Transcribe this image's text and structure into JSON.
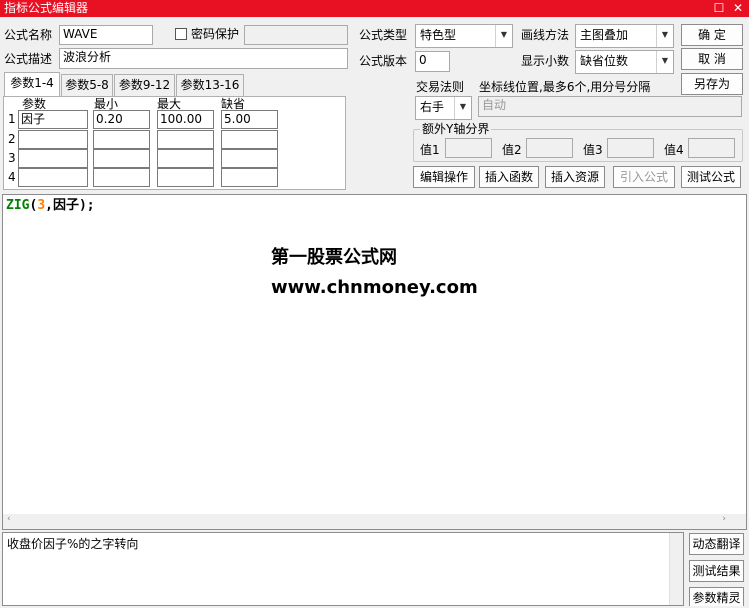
{
  "window": {
    "title": "指标公式编辑器",
    "restore_icon": "restore-icon",
    "close_icon": "close-icon"
  },
  "form": {
    "name_label": "公式名称",
    "name_value": "WAVE",
    "password_label": "密码保护",
    "password_checked": false,
    "password_value": "",
    "desc_label": "公式描述",
    "desc_value": "波浪分析",
    "type_label": "公式类型",
    "type_value": "特色型",
    "draw_label": "画线方法",
    "draw_value": "主图叠加",
    "version_label": "公式版本",
    "version_value": "0",
    "decimal_label": "显示小数",
    "decimal_value": "缺省位数"
  },
  "buttons": {
    "ok": "确  定",
    "cancel": "取  消",
    "save_as": "另存为",
    "edit": "编辑操作",
    "insert_func": "插入函数",
    "insert_res": "插入资源",
    "import": "引入公式",
    "test": "测试公式"
  },
  "trade": {
    "label": "交易法则",
    "value": "右手",
    "coord_label": "坐标线位置,最多6个,用分号分隔",
    "coord_placeholder": "自动"
  },
  "yaxis": {
    "group_label": "额外Y轴分界",
    "v1": "值1",
    "v2": "值2",
    "v3": "值3",
    "v4": "值4"
  },
  "tabs": [
    "参数1-4",
    "参数5-8",
    "参数9-12",
    "参数13-16"
  ],
  "params": {
    "headers": [
      "参数",
      "最小",
      "最大",
      "缺省"
    ],
    "rows": [
      {
        "n": "1",
        "name": "因子",
        "min": "0.20",
        "max": "100.00",
        "def": "5.00"
      },
      {
        "n": "2",
        "name": "",
        "min": "",
        "max": "",
        "def": ""
      },
      {
        "n": "3",
        "name": "",
        "min": "",
        "max": "",
        "def": ""
      },
      {
        "n": "4",
        "name": "",
        "min": "",
        "max": "",
        "def": ""
      }
    ]
  },
  "editor": {
    "code_func": "ZIG",
    "code_open": "(",
    "code_num": "3",
    "code_rest": ",因子);",
    "watermark1": "第一股票公式网",
    "watermark2": "www.chnmoney.com",
    "colors": {
      "func": "#008000",
      "num": "#ff8000"
    }
  },
  "description": "收盘价因子%的之字转向",
  "side_buttons": [
    "动态翻译",
    "测试结果",
    "参数精灵"
  ]
}
